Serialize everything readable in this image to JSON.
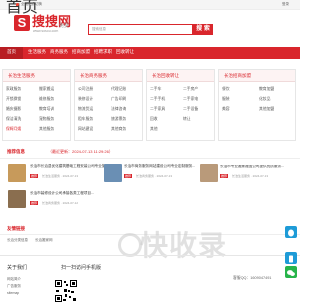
{
  "topbar": {
    "left_text": "首页",
    "city": "全国站点切换",
    "right_text": "登录"
  },
  "header": {
    "logo_glyph": "S",
    "logo_text": "搜搜网",
    "logo_url": "www.sosou.com",
    "slogan": "- 免费",
    "search_placeholder": "搜索信息",
    "search_button": "搜 索"
  },
  "nav": [
    "首页",
    "生活服务",
    "商务服务",
    "招商加盟",
    "招聘求职",
    "回收转让"
  ],
  "cards": [
    {
      "title": "长治生活服务",
      "links": [
        [
          "家政服务",
          "搬家搬运"
        ],
        [
          "开锁换锁",
          "维修服务"
        ],
        [
          "婚庆摄影",
          "教育培训"
        ],
        [
          "保洁清洗",
          "宠物服务"
        ],
        [
          "保姆月嫂",
          "其他服务"
        ]
      ]
    },
    {
      "title": "长治商务服务",
      "links": [
        [
          "公司注册",
          "代理记账"
        ],
        [
          "装修设计",
          "广告印刷"
        ],
        [
          "物流货运",
          "法律咨询"
        ],
        [
          "租车服务",
          "旅游票务"
        ],
        [
          "网站建设",
          "其他商务"
        ]
      ]
    },
    {
      "title": "长治回收转让",
      "links": [
        [
          "二手车",
          "二手房产"
        ],
        [
          "二手手机",
          "二手家电"
        ],
        [
          "二手家具",
          "二手设备"
        ],
        [
          "回收",
          "转让"
        ],
        [
          "其他",
          ""
        ]
      ]
    },
    {
      "title": "长治招商加盟",
      "links": [
        [
          "餐饮",
          "教育加盟"
        ],
        [
          "服装",
          "化妆品"
        ],
        [
          "美容",
          "其他加盟"
        ]
      ]
    }
  ],
  "recommended": {
    "title": "推荐信息",
    "update": "（最近更新：2024-07-13 11:29:26）",
    "items": [
      {
        "title": "长治市长治县优化建筑基础工程安装公司专业施工...",
        "meta": "长治生活服务 · 2024-07-13",
        "badge": "推荐",
        "thumb": "#c79a5b"
      },
      {
        "title": "长治市商务服务网站建设公司专业定制服务...",
        "meta": "长治商务服务 · 2024-07-13",
        "badge": "推荐",
        "thumb": "#6a8fb4"
      },
      {
        "title": "长治市专业搬家搬运公司提供优质服务...",
        "meta": "长治生活服务 · 2024-07-13",
        "badge": "推荐",
        "thumb": "#b99a7a"
      },
      {
        "title": "长治市装修设计公司承接各类工程项目...",
        "meta": "长治商务服务 · 2024-07-12",
        "badge": "推荐",
        "thumb": "#8a6e4f"
      }
    ]
  },
  "friends": {
    "title": "友情链接",
    "links": [
      "长治分类信息",
      "长治搬家网"
    ]
  },
  "footer": {
    "about_title": "关于我们",
    "about_links": [
      "网站简介",
      "广告服务",
      "sitemap"
    ],
    "qr_title": "扫一扫访问手机版",
    "contact": "客服QQ：1609047491"
  },
  "watermark": "快收录",
  "colors": {
    "accent": "#d9262c"
  }
}
